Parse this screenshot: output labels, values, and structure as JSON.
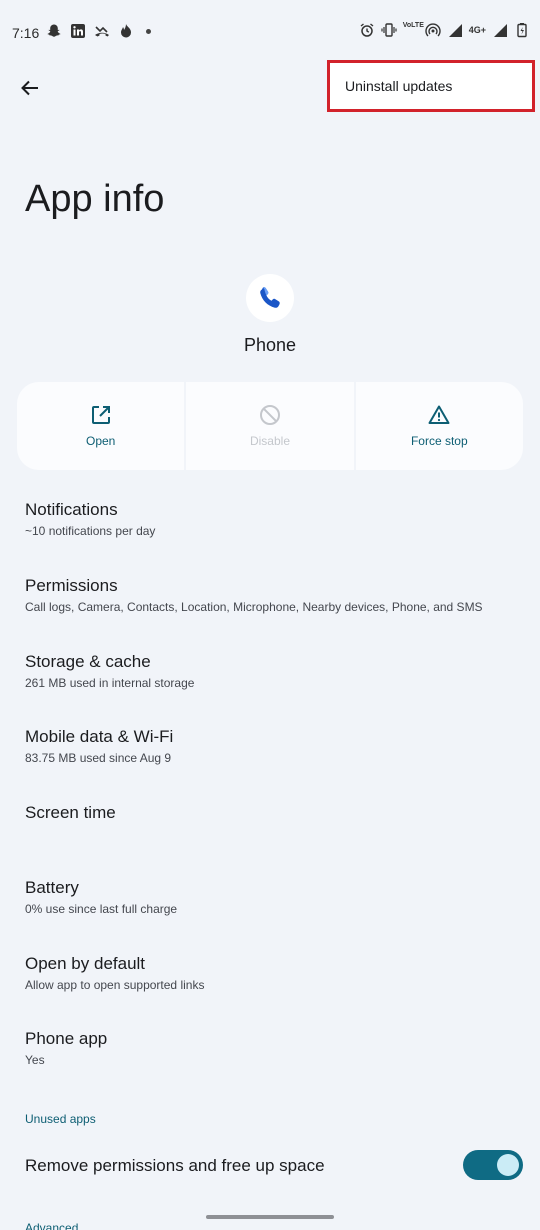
{
  "status_bar": {
    "time": "7:16",
    "left_icons": [
      "snapchat-icon",
      "linkedin-icon",
      "missed-call-icon",
      "flame-icon",
      "dot-icon"
    ],
    "right_icons": [
      "alarm-icon",
      "vibrate-icon",
      "volte-icon",
      "hotspot-icon",
      "signal-icon",
      "network-4g-icon",
      "signal-icon",
      "battery-icon"
    ],
    "volte_label": "VoLTE",
    "network_label": "4G+"
  },
  "menu": {
    "uninstall_updates": "Uninstall updates"
  },
  "page": {
    "title": "App info"
  },
  "app": {
    "name": "Phone"
  },
  "actions": {
    "open": "Open",
    "disable": "Disable",
    "force_stop": "Force stop"
  },
  "list": {
    "notifications": {
      "title": "Notifications",
      "subtitle": "~10 notifications per day"
    },
    "permissions": {
      "title": "Permissions",
      "subtitle": "Call logs, Camera, Contacts, Location, Microphone, Nearby devices, Phone, and SMS"
    },
    "storage": {
      "title": "Storage & cache",
      "subtitle": "261 MB used in internal storage"
    },
    "mobile_data": {
      "title": "Mobile data & Wi-Fi",
      "subtitle": "83.75 MB used since Aug 9"
    },
    "screen_time": {
      "title": "Screen time"
    },
    "battery": {
      "title": "Battery",
      "subtitle": "0% use since last full charge"
    },
    "open_by_default": {
      "title": "Open by default",
      "subtitle": "Allow app to open supported links"
    },
    "phone_app": {
      "title": "Phone app",
      "subtitle": "Yes"
    }
  },
  "unused_apps": {
    "header": "Unused apps",
    "remove_permissions": "Remove permissions and free up space",
    "toggle_on": true
  },
  "advanced": {
    "header": "Advanced"
  },
  "colors": {
    "accent": "#0d5e73",
    "toggle_track": "#0f6b84",
    "highlight_border": "#d2222b",
    "background": "#f1f4f9"
  }
}
